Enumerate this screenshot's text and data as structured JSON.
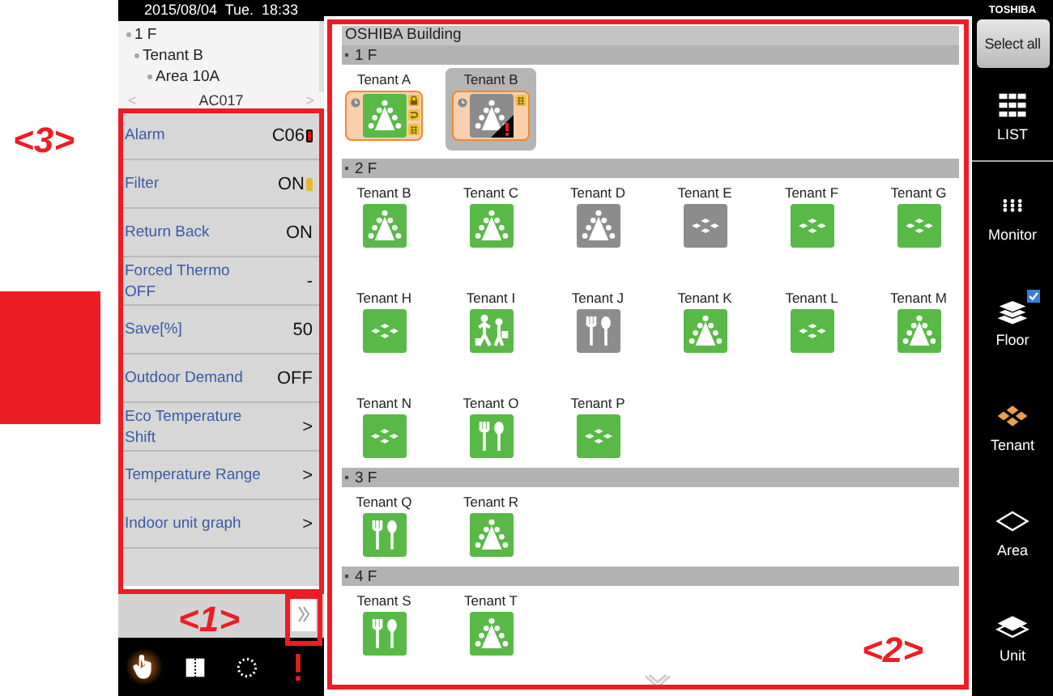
{
  "left_panel": {
    "datetime": "2015/08/04  Tue.  18:33",
    "tree": [
      {
        "label": "1 F",
        "children": [
          {
            "label": "Tenant B",
            "children": [
              {
                "label": "Area 10A"
              }
            ]
          }
        ]
      }
    ],
    "unit_nav": {
      "prev": "<",
      "name": "AC017",
      "next": ">"
    },
    "settings": [
      {
        "label": "Alarm",
        "value": "C06",
        "kind": "alarm"
      },
      {
        "label": "Filter",
        "value": "ON",
        "kind": "filter"
      },
      {
        "label": "Return Back",
        "value": "ON",
        "kind": "plain"
      },
      {
        "label": "Forced Thermo OFF",
        "value": "-",
        "kind": "plain"
      },
      {
        "label": "Save[%]",
        "value": "50",
        "kind": "plain"
      },
      {
        "label": "Outdoor Demand",
        "value": "OFF",
        "kind": "plain"
      },
      {
        "label": "Eco Temperature Shift",
        "value": ">",
        "kind": "plain"
      },
      {
        "label": "Temperature Range",
        "value": ">",
        "kind": "plain"
      },
      {
        "label": "Indoor unit graph",
        "value": ">",
        "kind": "plain"
      }
    ],
    "toolbar": [
      {
        "kind": "hand",
        "selected": true
      },
      {
        "kind": "book",
        "selected": false
      },
      {
        "kind": "ring",
        "selected": false
      },
      {
        "kind": "alert",
        "selected": false
      }
    ]
  },
  "main": {
    "building": "OSHIBA Building",
    "floors": [
      {
        "label": "1 F",
        "tenants": [
          {
            "label": "Tenant A",
            "kind": "people",
            "on": true,
            "selected": false,
            "marked": true,
            "alarm": false,
            "timer": true,
            "badges": [
              {
                "kind": "lock"
              },
              {
                "kind": "swing"
              },
              {
                "kind": "filter"
              }
            ]
          },
          {
            "label": "Tenant B",
            "kind": "people",
            "on": false,
            "selected": true,
            "marked": true,
            "alarm": true,
            "timer": true,
            "badges": [
              {
                "kind": "filter"
              }
            ]
          }
        ]
      },
      {
        "label": "2 F",
        "tenants": [
          {
            "label": "Tenant B",
            "kind": "people",
            "on": true,
            "selected": false,
            "marked": false,
            "alarm": false,
            "timer": false
          },
          {
            "label": "Tenant C",
            "kind": "people",
            "on": true,
            "selected": false,
            "marked": false,
            "alarm": false,
            "timer": false
          },
          {
            "label": "Tenant D",
            "kind": "people",
            "on": false,
            "selected": false,
            "marked": false,
            "alarm": false,
            "timer": false
          },
          {
            "label": "Tenant E",
            "kind": "ceiling",
            "on": false,
            "selected": false,
            "marked": false,
            "alarm": false,
            "timer": false
          },
          {
            "label": "Tenant F",
            "kind": "ceiling",
            "on": true,
            "selected": false,
            "marked": false,
            "alarm": false,
            "timer": false
          },
          {
            "label": "Tenant G",
            "kind": "ceiling",
            "on": true,
            "selected": false,
            "marked": false,
            "alarm": false,
            "timer": false
          },
          {
            "label": "Tenant H",
            "kind": "ceiling",
            "on": true,
            "selected": false,
            "marked": false,
            "alarm": false,
            "timer": false
          },
          {
            "label": "Tenant I",
            "kind": "shop",
            "on": true,
            "selected": false,
            "marked": false,
            "alarm": false,
            "timer": false
          },
          {
            "label": "Tenant J",
            "kind": "restaurant",
            "on": false,
            "selected": false,
            "marked": false,
            "alarm": false,
            "timer": false
          },
          {
            "label": "Tenant K",
            "kind": "people",
            "on": true,
            "selected": false,
            "marked": false,
            "alarm": false,
            "timer": false
          },
          {
            "label": "Tenant L",
            "kind": "ceiling",
            "on": true,
            "selected": false,
            "marked": false,
            "alarm": false,
            "timer": false
          },
          {
            "label": "Tenant M",
            "kind": "people",
            "on": true,
            "selected": false,
            "marked": false,
            "alarm": false,
            "timer": false
          },
          {
            "label": "Tenant N",
            "kind": "ceiling",
            "on": true,
            "selected": false,
            "marked": false,
            "alarm": false,
            "timer": false
          },
          {
            "label": "Tenant O",
            "kind": "restaurant",
            "on": true,
            "selected": false,
            "marked": false,
            "alarm": false,
            "timer": false
          },
          {
            "label": "Tenant P",
            "kind": "ceiling",
            "on": true,
            "selected": false,
            "marked": false,
            "alarm": false,
            "timer": false
          }
        ]
      },
      {
        "label": "3 F",
        "tenants": [
          {
            "label": "Tenant Q",
            "kind": "restaurant",
            "on": true,
            "selected": false,
            "marked": false,
            "alarm": false,
            "timer": false
          },
          {
            "label": "Tenant R",
            "kind": "people",
            "on": true,
            "selected": false,
            "marked": false,
            "alarm": false,
            "timer": false
          }
        ]
      },
      {
        "label": "4 F",
        "tenants": [
          {
            "label": "Tenant S",
            "kind": "restaurant",
            "on": true,
            "selected": false,
            "marked": false,
            "alarm": false,
            "timer": false
          },
          {
            "label": "Tenant T",
            "kind": "people",
            "on": true,
            "selected": false,
            "marked": false,
            "alarm": false,
            "timer": false
          }
        ]
      }
    ]
  },
  "sidebar": {
    "logo": "TOSHIBA",
    "select_all": "Select all",
    "buttons": [
      {
        "label": "LIST",
        "kind": "list",
        "selected": false
      },
      {
        "label": "Monitor",
        "kind": "monitor",
        "selected": false
      },
      {
        "label": "Floor",
        "kind": "floor",
        "selected": false,
        "checked": true
      },
      {
        "label": "Tenant",
        "kind": "tenant",
        "selected": true
      },
      {
        "label": "Area",
        "kind": "area",
        "selected": false
      },
      {
        "label": "Unit",
        "kind": "unit",
        "selected": false
      }
    ]
  },
  "annotations": [
    {
      "label": "<3>"
    },
    {
      "label": "<1>"
    },
    {
      "label": "<2>"
    }
  ]
}
